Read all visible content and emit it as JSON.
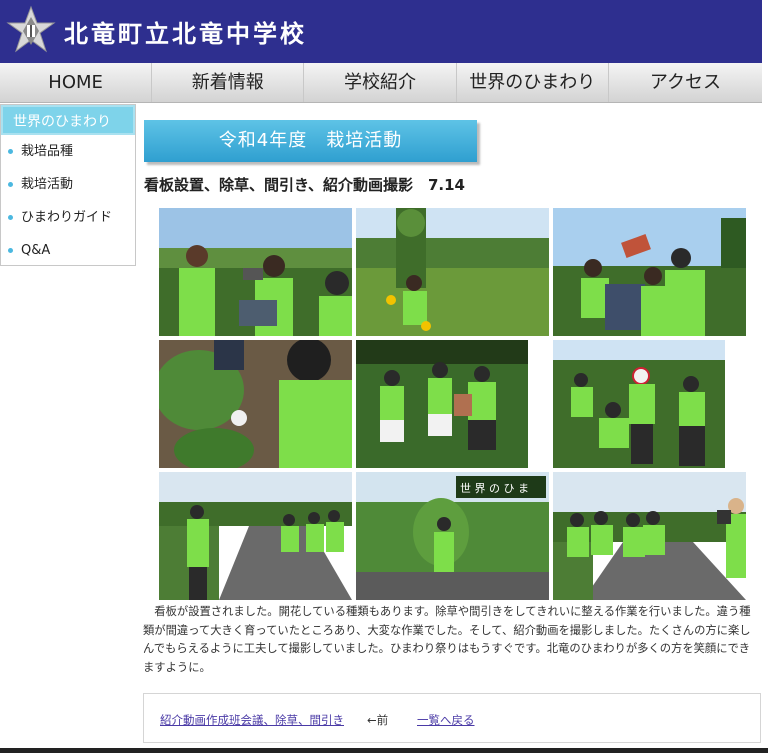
{
  "header": {
    "title": "北竜町立北竜中学校",
    "logo": "school-crest-icon"
  },
  "nav": {
    "items": [
      "HOME",
      "新着情報",
      "学校紹介",
      "世界のひまわり",
      "アクセス"
    ]
  },
  "sidebar": {
    "heading": "世界のひまわり",
    "items": [
      "栽培品種",
      "栽培活動",
      "ひまわりガイド",
      "Q&A"
    ]
  },
  "main": {
    "banner": "令和4年度　栽培活動",
    "headline": "看板設置、除草、間引き、紹介動画撮影　7.14",
    "photo_sign_text": "世 界 の ひ ま",
    "caption": "　看板が設置されました。開花している種類もあります。除草や間引きをしてきれいに整える作業を行いました。違う種類が間違って大きく育っていたところあり、大変な作業でした。そして、紹介動画を撮影しました。たくさんの方に楽しんでもらえるように工夫して撮影していました。ひまわり祭りはもうすぐです。北竜のひまわりが多くの方を笑顔にできますように。"
  },
  "footer": {
    "prev_link": "紹介動画作成班会議、除草、間引き",
    "prev_label": "←前",
    "list_link": "一覧へ戻る"
  },
  "colors": {
    "header_bg": "#2e2f8f",
    "banner": "#3aaad8",
    "link": "#4a3aa6",
    "shirt": "#7ede4a"
  }
}
